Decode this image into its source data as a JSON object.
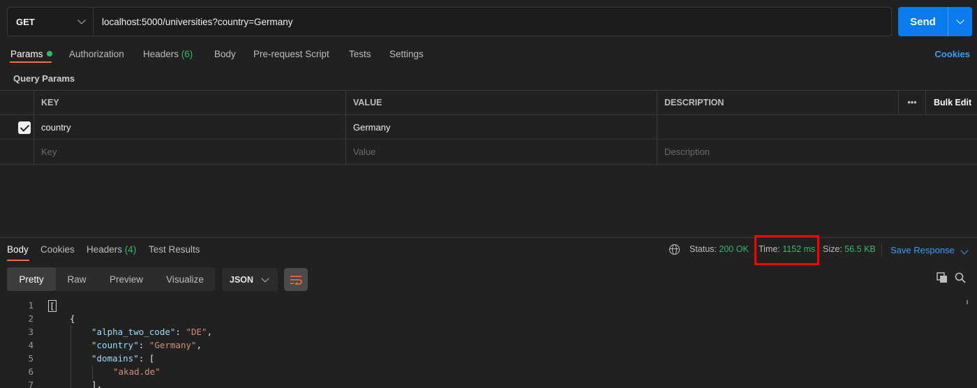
{
  "request": {
    "method": "GET",
    "url": "localhost:5000/universities?country=Germany",
    "send_label": "Send"
  },
  "request_tabs": {
    "params": "Params",
    "authorization": "Authorization",
    "headers": "Headers",
    "headers_count": "(6)",
    "body": "Body",
    "pre_request": "Pre-request Script",
    "tests": "Tests",
    "settings": "Settings",
    "cookies": "Cookies"
  },
  "query_params": {
    "title": "Query Params",
    "headers": {
      "key": "KEY",
      "value": "VALUE",
      "description": "DESCRIPTION",
      "more": "•••",
      "bulk_edit": "Bulk Edit"
    },
    "rows": [
      {
        "checked": true,
        "key": "country",
        "value": "Germany",
        "description": ""
      }
    ],
    "placeholders": {
      "key": "Key",
      "value": "Value",
      "description": "Description"
    }
  },
  "response_tabs": {
    "body": "Body",
    "cookies": "Cookies",
    "headers": "Headers",
    "headers_count": "(4)",
    "test_results": "Test Results"
  },
  "response_meta": {
    "status_label": "Status:",
    "status_value": "200 OK",
    "time_label": "Time:",
    "time_value": "1152 ms",
    "size_label": "Size:",
    "size_value": "56.5 KB",
    "save_response": "Save Response"
  },
  "view": {
    "modes": [
      "Pretty",
      "Raw",
      "Preview",
      "Visualize"
    ],
    "active_mode": "Pretty",
    "format": "JSON"
  },
  "code": {
    "line_numbers": [
      "1",
      "2",
      "3",
      "4",
      "5",
      "6",
      "7"
    ],
    "bracket_open": "[",
    "brace_open": "{",
    "k_alpha": "\"alpha_two_code\"",
    "v_alpha": "\"DE\"",
    "k_country": "\"country\"",
    "v_country": "\"Germany\"",
    "k_domains": "\"domains\"",
    "v_domain_1": "\"akad.de\"",
    "close_array": "],"
  },
  "colors": {
    "accent": "#097bed",
    "tab_underline": "#ff6c37",
    "status_ok": "#32b96a",
    "highlight": "#ff0000",
    "link": "#3d9bf5"
  }
}
